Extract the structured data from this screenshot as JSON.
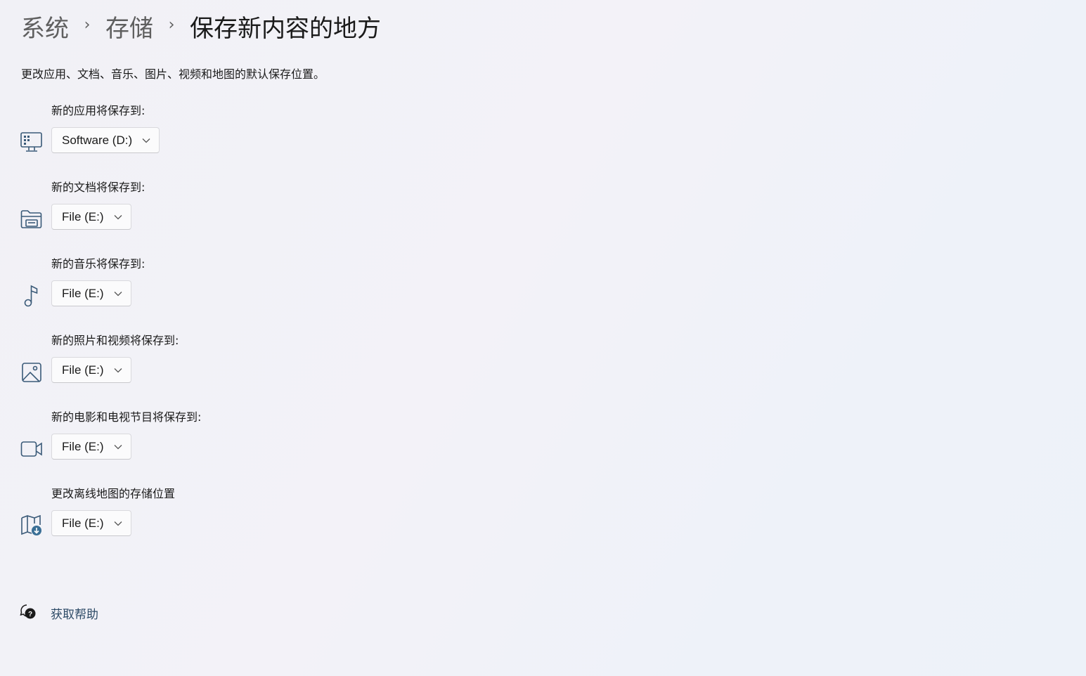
{
  "breadcrumb": {
    "items": [
      "系统",
      "存储"
    ],
    "separator": "›",
    "current": "保存新内容的地方"
  },
  "description": "更改应用、文档、音乐、图片、视频和地图的默认保存位置。",
  "settings": [
    {
      "label": "新的应用将保存到:",
      "value": "Software (D:)",
      "icon": "apps-monitor-icon"
    },
    {
      "label": "新的文档将保存到:",
      "value": "File (E:)",
      "icon": "folder-documents-icon"
    },
    {
      "label": "新的音乐将保存到:",
      "value": "File (E:)",
      "icon": "music-note-icon"
    },
    {
      "label": "新的照片和视频将保存到:",
      "value": "File (E:)",
      "icon": "picture-icon"
    },
    {
      "label": "新的电影和电视节目将保存到:",
      "value": "File (E:)",
      "icon": "video-camera-icon"
    },
    {
      "label": "更改离线地图的存储位置",
      "value": "File (E:)",
      "icon": "offline-map-icon"
    }
  ],
  "help": {
    "label": "获取帮助",
    "icon": "help-chat-icon"
  },
  "colors": {
    "icon": "#3a5a78",
    "accent": "#3a6f96"
  }
}
